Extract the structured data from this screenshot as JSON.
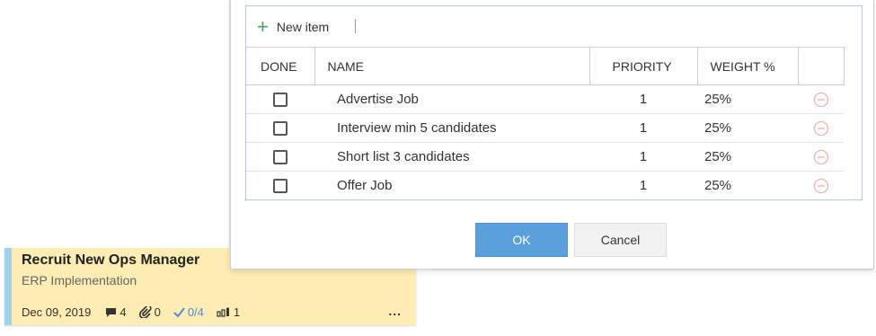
{
  "dialog": {
    "toolbar": {
      "new_item_label": "New item"
    },
    "columns": {
      "done": "DONE",
      "name": "NAME",
      "priority": "PRIORITY",
      "weight": "WEIGHT %"
    },
    "rows": [
      {
        "done": false,
        "name": "Advertise Job",
        "priority": "1",
        "weight": "25%"
      },
      {
        "done": false,
        "name": "Interview min 5 candidates",
        "priority": "1",
        "weight": "25%"
      },
      {
        "done": false,
        "name": "Short list 3 candidates",
        "priority": "1",
        "weight": "25%"
      },
      {
        "done": false,
        "name": "Offer Job",
        "priority": "1",
        "weight": "25%"
      }
    ],
    "ok_label": "OK",
    "cancel_label": "Cancel"
  },
  "task_card": {
    "title": "Recruit New Ops Manager",
    "project": "ERP Implementation",
    "date": "Dec 09, 2019",
    "comments": "4",
    "attachments": "0",
    "checklist": "0/4",
    "rank": "1",
    "more_label": "..."
  },
  "colors": {
    "card_bg": "#fdecb3",
    "card_stripe": "#9fd3e9",
    "ok_button": "#5b9fdc",
    "plus_icon": "#3aaa5c",
    "remove_icon": "#f0b3a8",
    "check_icon": "#4a90d9"
  }
}
